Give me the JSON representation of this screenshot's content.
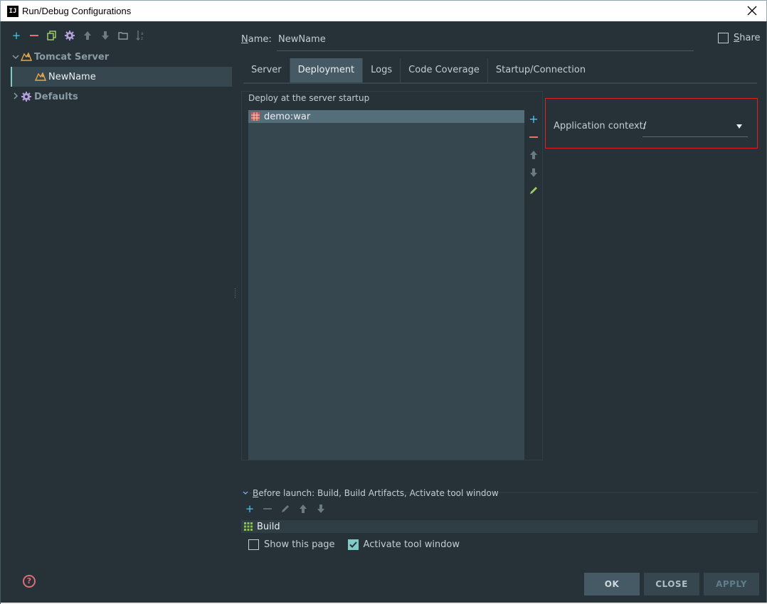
{
  "window": {
    "title": "Run/Debug Configurations",
    "app_icon_label": "IJ"
  },
  "tree": {
    "groups": [
      {
        "label": "Tomcat Server",
        "children": [
          {
            "label": "NewName"
          }
        ]
      },
      {
        "label": "Defaults",
        "children": []
      }
    ]
  },
  "config": {
    "name_label_mnemonic": "N",
    "name_label_rest": "ame:",
    "name_value": "NewName",
    "share_label_mnemonic": "S",
    "share_label_rest": "hare",
    "share_checked": false
  },
  "tabs": [
    {
      "label": "Server",
      "active": false
    },
    {
      "label": "Deployment",
      "active": true
    },
    {
      "label": "Logs",
      "active": false
    },
    {
      "label": "Code Coverage",
      "active": false
    },
    {
      "label": "Startup/Connection",
      "active": false
    }
  ],
  "deployment": {
    "section_label": "Deploy at the server startup",
    "artifacts": [
      "demo:war"
    ],
    "application_context_label": "Application context:",
    "application_context_value": "/"
  },
  "before_launch": {
    "label_mnemonic": "B",
    "label_rest": "efore launch: Build, Build Artifacts, Activate tool window",
    "tasks": [
      "Build"
    ],
    "show_this_page": {
      "label": "Show this page",
      "checked": false
    },
    "activate_tool_window": {
      "label": "Activate tool window",
      "checked": true
    }
  },
  "buttons": {
    "ok": "OK",
    "close": "CLOSE",
    "apply": "APPLY"
  },
  "colors": {
    "accent": "#80cbc4",
    "background": "#263238",
    "highlight_box": "#e02020"
  }
}
